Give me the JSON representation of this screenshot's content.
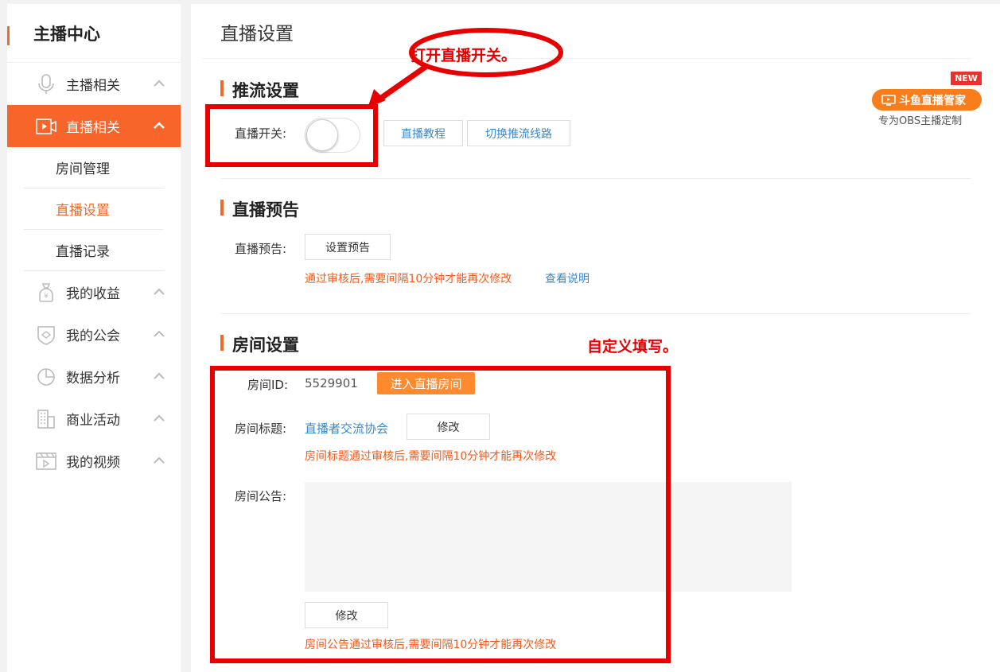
{
  "sidebar": {
    "title": "主播中心",
    "items": [
      {
        "label": "主播相关"
      },
      {
        "label": "直播相关"
      },
      {
        "label": "我的收益"
      },
      {
        "label": "我的公会"
      },
      {
        "label": "数据分析"
      },
      {
        "label": "商业活动"
      },
      {
        "label": "我的视频"
      }
    ],
    "subitems": [
      {
        "label": "房间管理"
      },
      {
        "label": "直播设置"
      },
      {
        "label": "直播记录"
      }
    ]
  },
  "page": {
    "title": "直播设置"
  },
  "stream": {
    "section_title": "推流设置",
    "switch_label": "直播开关:",
    "tutorial_button": "直播教程",
    "switch_line_button": "切换推流线路"
  },
  "preview": {
    "section_title": "直播预告",
    "label": "直播预告:",
    "set_button": "设置预告",
    "hint": "通过审核后,需要间隔10分钟才能再次修改",
    "help_link": "查看说明"
  },
  "room": {
    "section_title": "房间设置",
    "id_label": "房间ID:",
    "id_value": "5529901",
    "enter_button": "进入直播房间",
    "title_label": "房间标题:",
    "title_value": "直播者交流协会",
    "title_edit_button": "修改",
    "title_hint": "房间标题通过审核后,需要间隔10分钟才能再次修改",
    "notice_label": "房间公告:",
    "notice_edit_button": "修改",
    "notice_hint": "房间公告通过审核后,需要间隔10分钟才能再次修改"
  },
  "promo": {
    "badge": "NEW",
    "label": "斗鱼直播管家",
    "subtitle": "专为OBS主播定制"
  },
  "annotations": {
    "switch_note": "打开直播开关。",
    "custom_note": "自定义填写。"
  },
  "colors": {
    "accent": "#f7652a",
    "link": "#3a88c8",
    "hint": "#f05a1a",
    "annotation": "#e80000"
  }
}
